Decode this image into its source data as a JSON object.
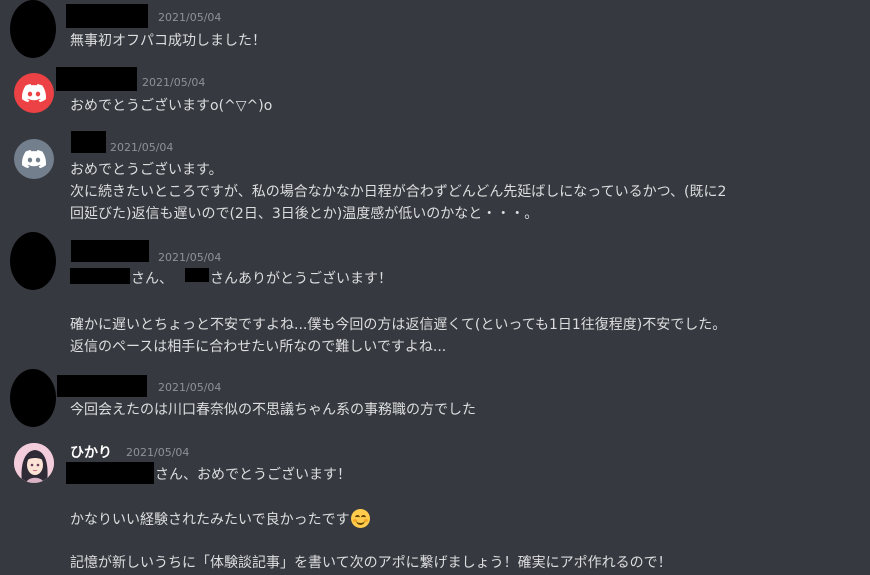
{
  "messages": [
    {
      "date": "2021/05/04",
      "lines": [
        "無事初オフパコ成功しました！"
      ]
    },
    {
      "date": "2021/05/04",
      "lines": [
        "おめでとうございますo(^▽^)o"
      ]
    },
    {
      "date": "2021/05/04",
      "lines": [
        "おめでとうございます。",
        "次に続きたいところですが、私の場合なかなか日程が合わずどんどん先延ばしになっているかつ、(既に2",
        "回延びた)返信も遅いので(2日、3日後とか)温度感が低いのかなと・・・。"
      ]
    },
    {
      "date": "2021/05/04",
      "line1_part1": "さん、",
      "line1_part2": "さんありがとうございます！",
      "lines": [
        "確かに遅いとちょっと不安ですよね...僕も今回の方は返信遅くて(といっても1日1往復程度)不安でした。",
        "返信のペースは相手に合わせたい所なので難しいですよね..."
      ]
    },
    {
      "date": "2021/05/04",
      "lines": [
        "今回会えたのは川口春奈似の不思議ちゃん系の事務職の方でした"
      ]
    },
    {
      "username": "ひかり",
      "date": "2021/05/04",
      "line1": "さん、おめでとうございます！",
      "lines": [
        "かなりいい経験されたみたいで良かったです",
        "記憶が新しいうちに「体験談記事」を書いて次のアポに繋げましょう！確実にアポ作れるので！"
      ]
    }
  ],
  "icons": {
    "discord_red_color": "#ed4245",
    "discord_grey_color": "#747f8d",
    "emoji": "smiling-face-with-smiling-eyes"
  }
}
